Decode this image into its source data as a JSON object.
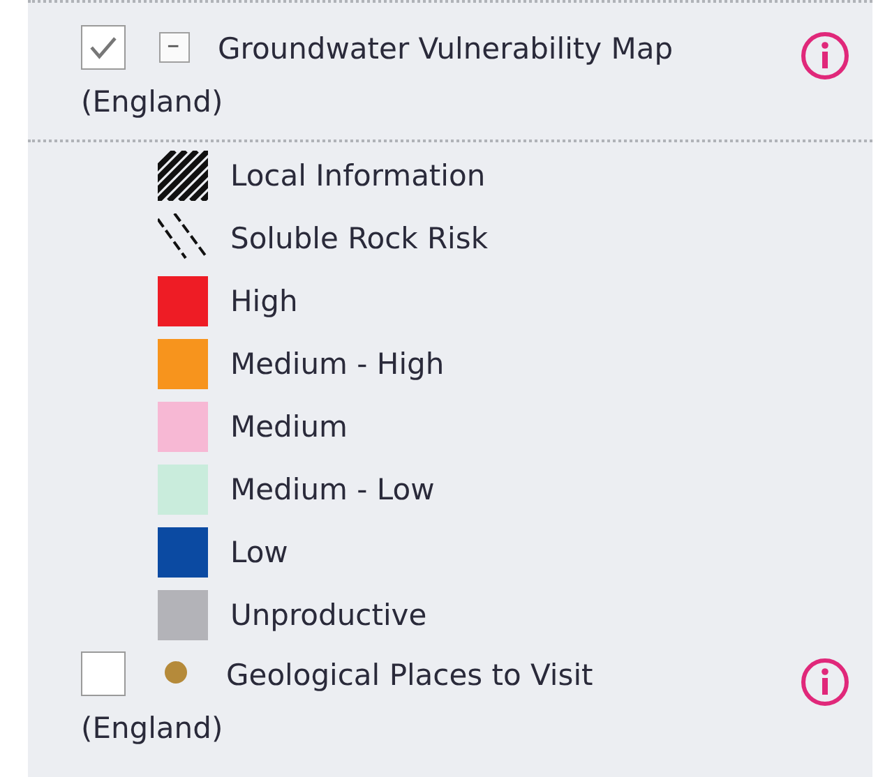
{
  "layers": [
    {
      "kind": "group",
      "title_lines": [
        "Groundwater Vulnerability Map",
        "(England)"
      ],
      "checked": true,
      "expanded": true,
      "legend": [
        {
          "kind": "dense_hatch",
          "label": "Local Information"
        },
        {
          "kind": "sparse_hatch",
          "label": "Soluble Rock Risk"
        },
        {
          "kind": "swatch",
          "label": "High",
          "color": "#ee1c25"
        },
        {
          "kind": "swatch",
          "label": "Medium - High",
          "color": "#f7941d"
        },
        {
          "kind": "swatch",
          "label": "Medium",
          "color": "#f7b8d4"
        },
        {
          "kind": "swatch",
          "label": "Medium - Low",
          "color": "#c9ecdc"
        },
        {
          "kind": "swatch",
          "label": "Low",
          "color": "#0b4aa2"
        },
        {
          "kind": "swatch",
          "label": "Unproductive",
          "color": "#b3b3b8"
        }
      ]
    },
    {
      "kind": "single",
      "title_lines": [
        "Geological Places to Visit",
        "(England)"
      ],
      "checked": false,
      "color": "#b58a3a"
    }
  ]
}
